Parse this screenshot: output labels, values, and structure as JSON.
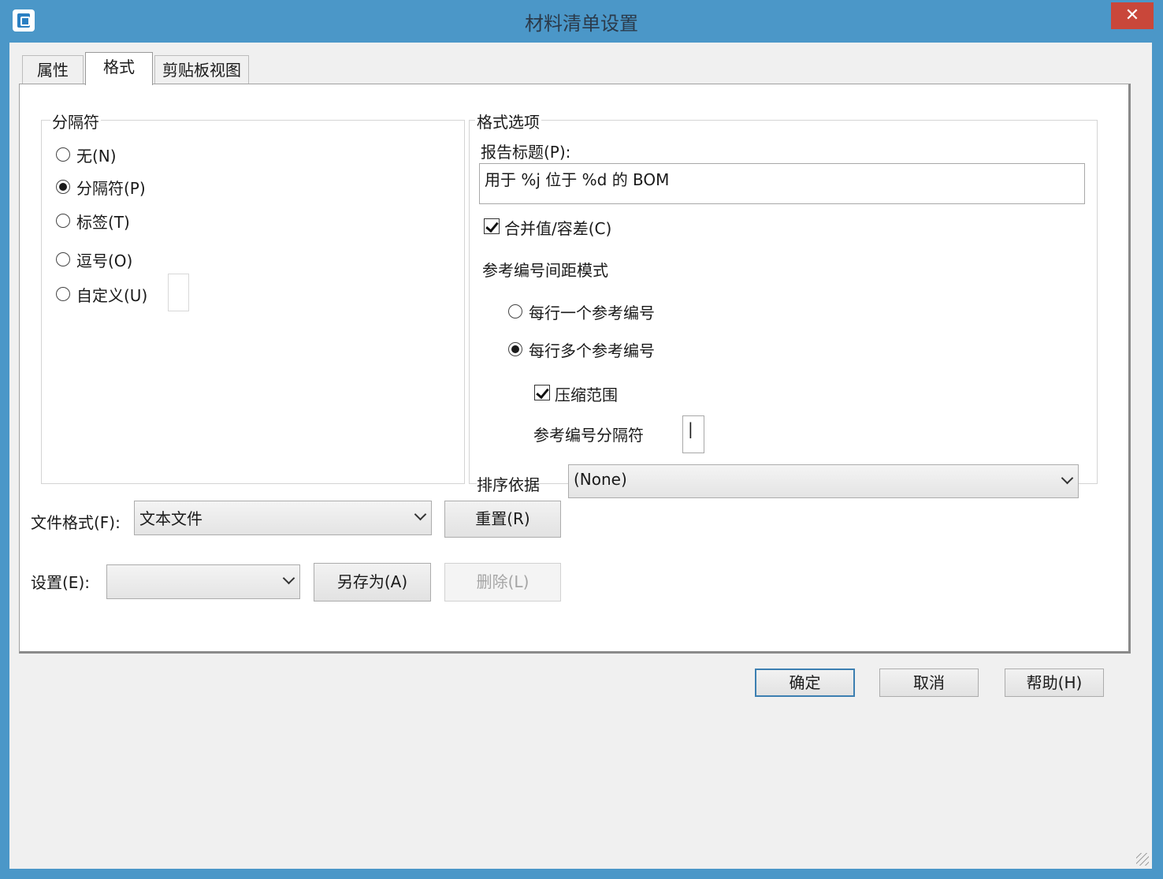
{
  "window": {
    "title": "材料清单设置",
    "close_glyph": "✕"
  },
  "tabs": [
    {
      "label": "属性"
    },
    {
      "label": "格式"
    },
    {
      "label": "剪贴板视图"
    }
  ],
  "delimiter_group": {
    "title": "分隔符",
    "options": [
      {
        "label": "无(N)",
        "checked": false
      },
      {
        "label": "分隔符(P)",
        "checked": true
      },
      {
        "label": "标签(T)",
        "checked": false
      },
      {
        "label": "逗号(O)",
        "checked": false
      },
      {
        "label": "自定义(U)",
        "checked": false
      }
    ],
    "custom_value": ""
  },
  "format_group": {
    "title": "格式选项",
    "report_title_label": "报告标题(P):",
    "report_title_value": "用于 %j 位于 %d 的 BOM",
    "merge_label": "合并值/容差(C)",
    "merge_checked": true,
    "ref_mode_label": "参考编号间距模式",
    "one_per_row_label": "每行一个参考编号",
    "multi_per_row_label": "每行多个参考编号",
    "multi_checked": true,
    "compress_label": "压缩范围",
    "compress_checked": true,
    "ref_sep_label": "参考编号分隔符",
    "ref_sep_value": "|",
    "sort_label": "排序依据",
    "sort_value": "(None)"
  },
  "file_format": {
    "label": "文件格式(F):",
    "value": "文本文件"
  },
  "reset_button": "重置(R)",
  "settings": {
    "label": "设置(E):",
    "value": ""
  },
  "save_as_button": "另存为(A)",
  "delete_button": "删除(L)",
  "footer": {
    "ok": "确定",
    "cancel": "取消",
    "help": "帮助(H)"
  }
}
